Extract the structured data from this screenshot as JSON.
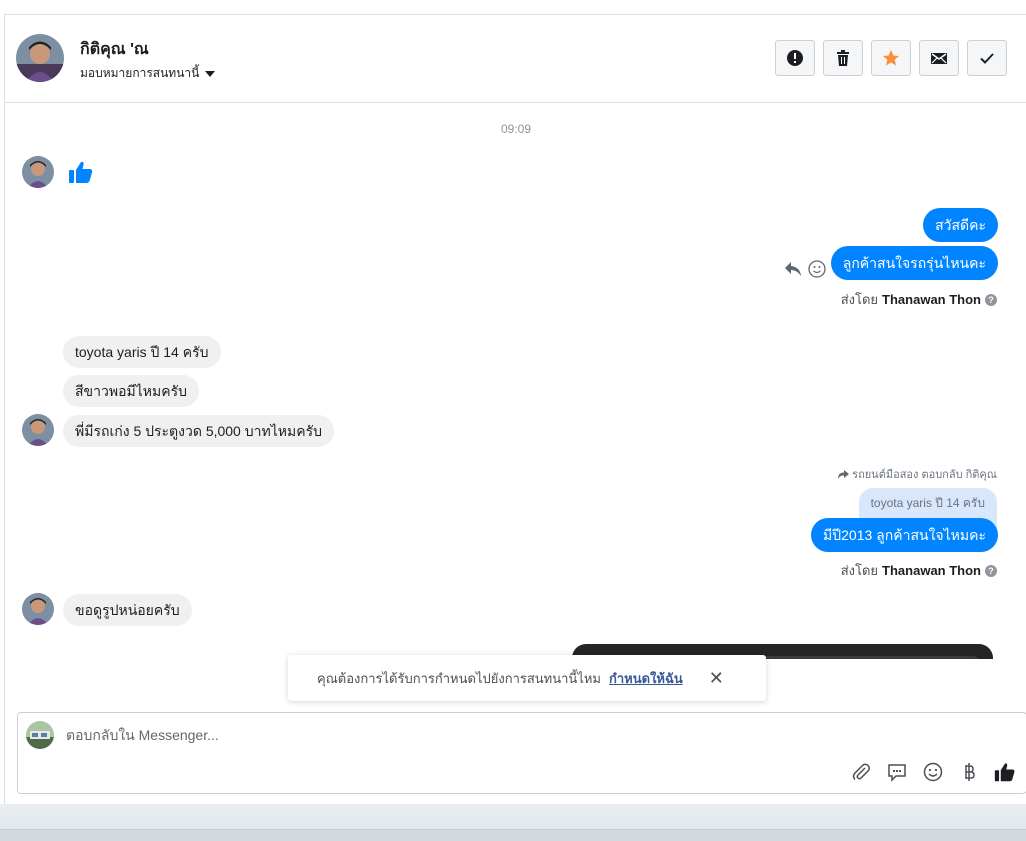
{
  "header": {
    "contact_name": "กิติคุณ 'ณ",
    "assign_label": "มอบหมายการสนทนานี้",
    "actions": [
      {
        "name": "spam-button",
        "icon": "exclamation-icon"
      },
      {
        "name": "delete-button",
        "icon": "trash-icon"
      },
      {
        "name": "star-button",
        "icon": "star-icon"
      },
      {
        "name": "mark-unread-button",
        "icon": "envelope-icon"
      },
      {
        "name": "mark-done-button",
        "icon": "check-icon"
      }
    ]
  },
  "chat": {
    "timestamp": "09:09",
    "messages_out_1": [
      "สวัสดีคะ",
      "ลูกค้าสนใจรถรุ่นไหนคะ"
    ],
    "sent_by_prefix": "ส่งโดย",
    "sent_by_name": "Thanawan Thon",
    "messages_in_1": [
      "toyota yaris ปี 14 ครับ",
      "สีขาวพอมีไหมครับ",
      "พี่มีรถเก่ง 5 ประตูงวด 5,000 บาทไหมครับ"
    ],
    "reply_hint": "รถยนต์มือสอง ตอบกลับ กิติคุณ",
    "quoted_text": "toyota yaris ปี 14 ครับ",
    "reply_message": "มีปี2013 ลูกค้าสนใจไหมคะ",
    "messages_in_2": [
      "ขอดูรูปหน่อยครับ"
    ]
  },
  "toast": {
    "text": "คุณต้องการได้รับการกำหนดไปยังการสนทนานี้ไหม",
    "link": "กำหนดให้ฉัน",
    "close": "✕"
  },
  "composer": {
    "placeholder": "ตอบกลับใน Messenger...",
    "tools": [
      "attach-icon",
      "saved-reply-icon",
      "emoji-icon",
      "baht-icon",
      "like-icon"
    ]
  },
  "colors": {
    "accent": "#0084ff",
    "star": "#f7923b",
    "incoming_bubble": "#f1f0f0"
  }
}
